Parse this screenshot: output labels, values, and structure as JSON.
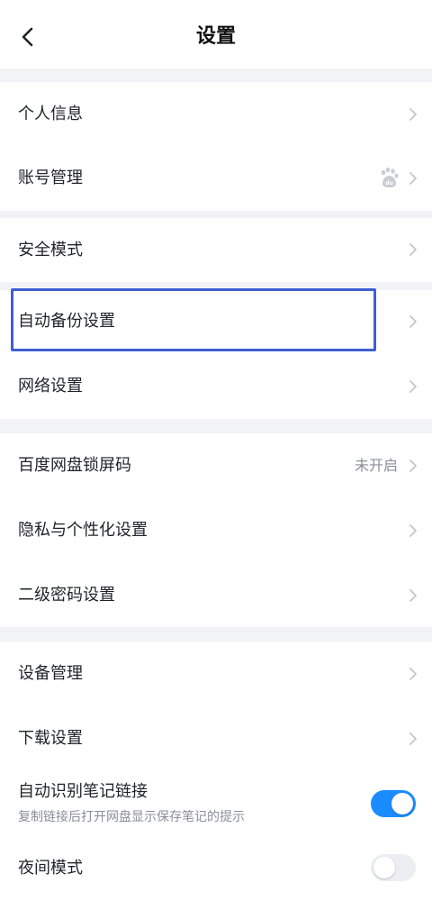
{
  "header": {
    "title": "设置",
    "back_icon": "chevron-left-icon"
  },
  "colors": {
    "accent": "#1a8cff",
    "highlight": "#3d5fd6",
    "gap": "#f2f3f6",
    "muted": "#8a8f99"
  },
  "items": {
    "personal_info": {
      "label": "个人信息"
    },
    "account": {
      "label": "账号管理",
      "icon": "baidu-paw-icon"
    },
    "safe_mode": {
      "label": "安全模式"
    },
    "auto_backup": {
      "label": "自动备份设置"
    },
    "network": {
      "label": "网络设置"
    },
    "lock_code": {
      "label": "百度网盘锁屏码",
      "value": "未开启"
    },
    "privacy": {
      "label": "隐私与个性化设置"
    },
    "secondary_password": {
      "label": "二级密码设置"
    },
    "devices": {
      "label": "设备管理"
    },
    "download": {
      "label": "下载设置"
    },
    "note_link": {
      "label": "自动识别笔记链接",
      "sub": "复制链接后打开网盘显示保存笔记的提示",
      "enabled": true
    },
    "night_mode": {
      "label": "夜间模式",
      "enabled": false
    }
  }
}
